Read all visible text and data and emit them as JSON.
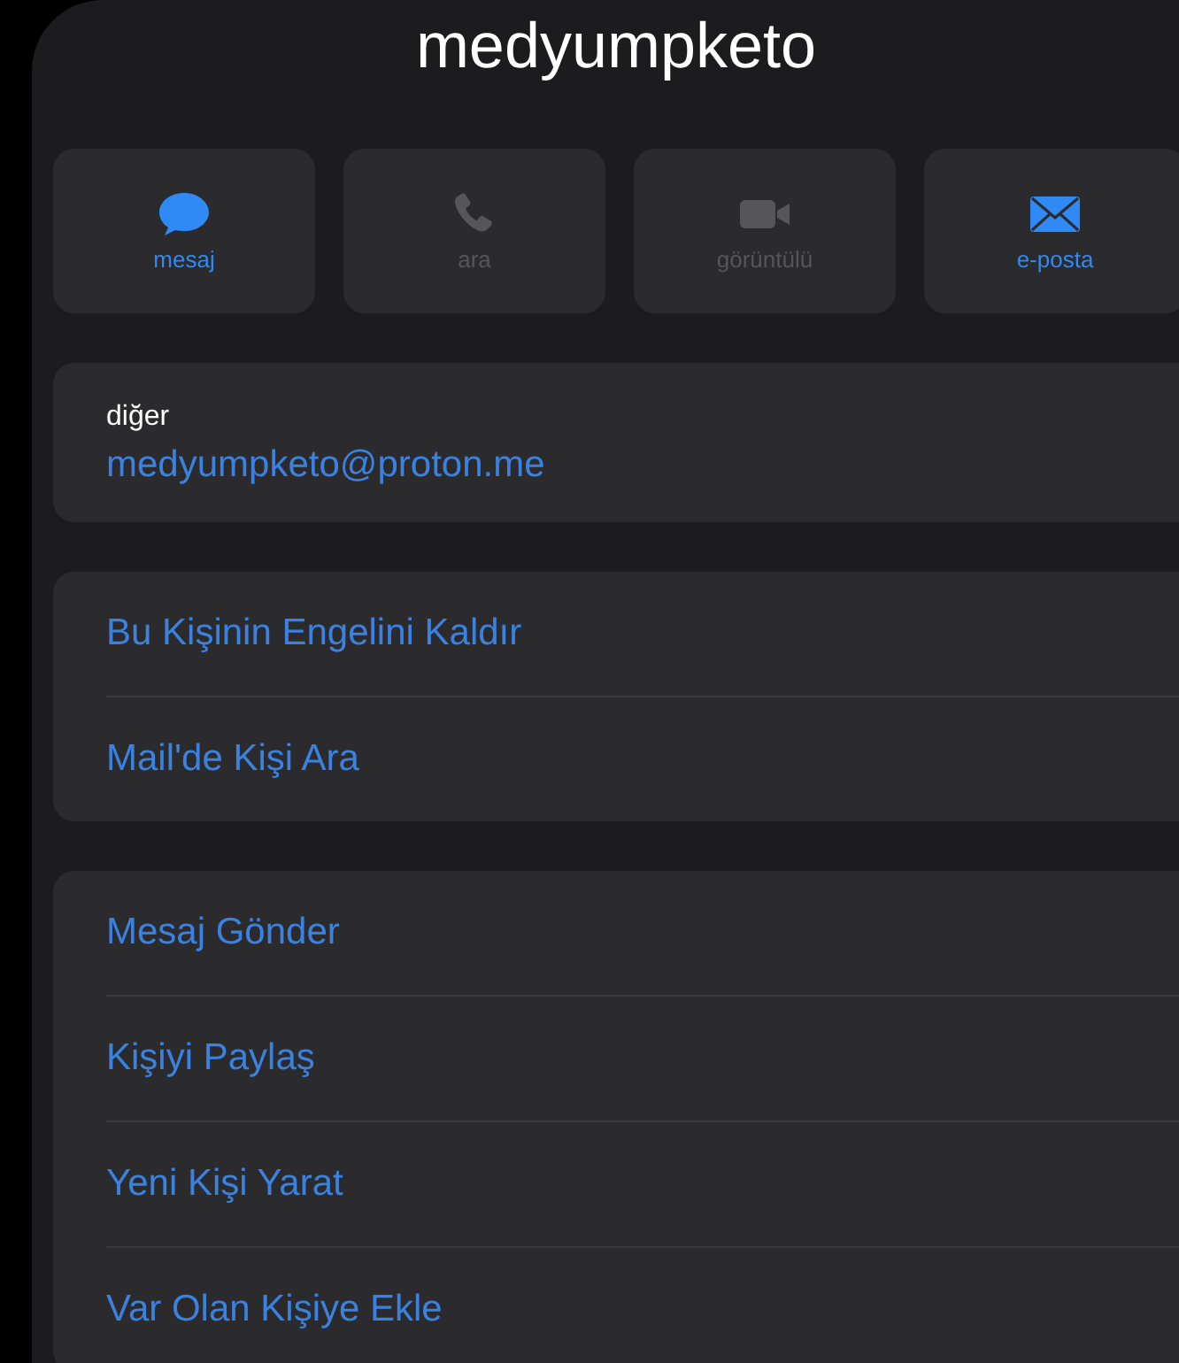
{
  "contact": {
    "name": "medyumpketo"
  },
  "actions": [
    {
      "kind": "message",
      "label": "mesaj",
      "disabled": false
    },
    {
      "kind": "call",
      "label": "ara",
      "disabled": true
    },
    {
      "kind": "video",
      "label": "görüntülü",
      "disabled": true
    },
    {
      "kind": "mail",
      "label": "e-posta",
      "disabled": false
    }
  ],
  "email": {
    "label": "diğer",
    "value": "medyumpketo@proton.me"
  },
  "groups": [
    [
      "Bu Kişinin Engelini Kaldır",
      "Mail'de Kişi Ara"
    ],
    [
      "Mesaj Gönder",
      "Kişiyi Paylaş",
      "Yeni Kişi Yarat",
      "Var Olan Kişiye Ekle"
    ]
  ]
}
